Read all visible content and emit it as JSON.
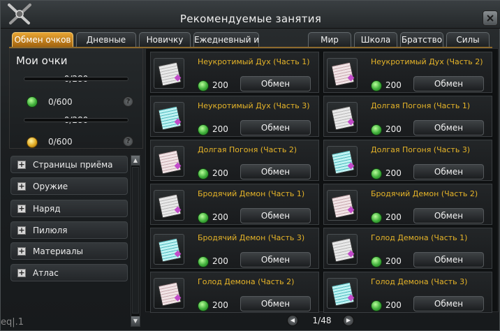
{
  "window": {
    "title": "Рекомендуемые занятия"
  },
  "tabs_left": [
    {
      "label": "Обмен очков",
      "active": true
    },
    {
      "label": "Дневные"
    },
    {
      "label": "Новичку"
    },
    {
      "label": "Ежедневный и..."
    }
  ],
  "tabs_right": [
    {
      "label": "Мир"
    },
    {
      "label": "Школа"
    },
    {
      "label": "Братство"
    },
    {
      "label": "Силы"
    }
  ],
  "points": {
    "title": "Мои очки",
    "bar1": "0/280",
    "green_value": "0/600",
    "bar2": "0/280",
    "gold_value": "0/600",
    "help": "?"
  },
  "categories": [
    {
      "label": "Страницы приёма"
    },
    {
      "label": "Оружие"
    },
    {
      "label": "Наряд"
    },
    {
      "label": "Пилюля"
    },
    {
      "label": "Материалы"
    },
    {
      "label": "Атлас"
    }
  ],
  "items": [
    {
      "name": "Неукротимый Дух (Часть 1)",
      "cost": "200",
      "button": "Обмен",
      "icon": "white-scroll-icon"
    },
    {
      "name": "Неукротимый Дух (Часть 2)",
      "cost": "200",
      "button": "Обмен",
      "icon": "pink-scroll-icon"
    },
    {
      "name": "Неукротимый Дух (Часть 3)",
      "cost": "200",
      "button": "Обмен",
      "icon": "cyan-scroll-icon"
    },
    {
      "name": "Долгая Погоня (Часть 1)",
      "cost": "200",
      "button": "Обмен",
      "icon": "white-scroll-icon"
    },
    {
      "name": "Долгая Погоня (Часть 2)",
      "cost": "200",
      "button": "Обмен",
      "icon": "pink-scroll-icon"
    },
    {
      "name": "Долгая Погоня (Часть 3)",
      "cost": "200",
      "button": "Обмен",
      "icon": "cyan-scroll-icon"
    },
    {
      "name": "Бродячий Демон (Часть 1)",
      "cost": "200",
      "button": "Обмен",
      "icon": "white-scroll-icon"
    },
    {
      "name": "Бродячий Демон (Часть 2)",
      "cost": "200",
      "button": "Обмен",
      "icon": "pink-scroll-icon"
    },
    {
      "name": "Бродячий Демон (Часть 3)",
      "cost": "200",
      "button": "Обмен",
      "icon": "cyan-scroll-icon"
    },
    {
      "name": "Голод Демона (Часть 1)",
      "cost": "200",
      "button": "Обмен",
      "icon": "white-scroll-icon"
    },
    {
      "name": "Голод Демона (Часть 2)",
      "cost": "200",
      "button": "Обмен",
      "icon": "pink-scroll-icon"
    },
    {
      "name": "Голод Демона (Часть 3)",
      "cost": "200",
      "button": "Обмен",
      "icon": "cyan-scroll-icon"
    }
  ],
  "pager": {
    "text": "1/48",
    "prev": "◀",
    "next": "▶"
  },
  "corner_text": "eq|.1",
  "colors": {
    "accent": "#e8a533",
    "item_name": "#e6b428",
    "coin_green": "#3fae3a",
    "coin_gold": "#e0a921"
  }
}
